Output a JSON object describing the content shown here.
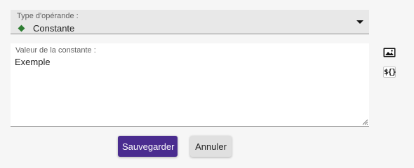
{
  "operand_select": {
    "label": "Type d'opérande :",
    "value": "Constante",
    "icon": "green-diamond-icon",
    "icon_color": "#2e7d32"
  },
  "constant_field": {
    "label": "Valeur de la constante :",
    "value": "Exemple"
  },
  "side_tools": {
    "image_icon": "image-icon",
    "variable_icon": "variable-icon",
    "variable_glyph": "${}"
  },
  "buttons": {
    "save_label": "Sauvegarder",
    "cancel_label": "Annuler",
    "save_color": "#4a2c8f"
  }
}
